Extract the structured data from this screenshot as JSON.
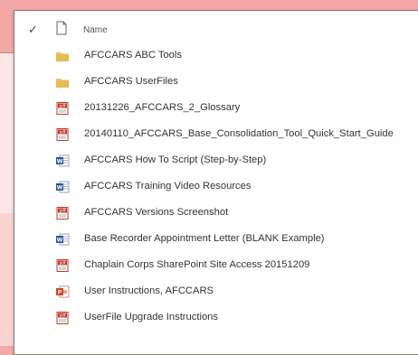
{
  "list": {
    "header": {
      "name_label": "Name",
      "check_glyph": "✓"
    },
    "items": [
      {
        "type": "folder",
        "icon": "folder-icon",
        "label": "AFCCARS ABC Tools"
      },
      {
        "type": "folder",
        "icon": "folder-icon",
        "label": "AFCCARS UserFiles"
      },
      {
        "type": "pdf",
        "icon": "pdf-icon",
        "label": "20131226_AFCCARS_2_Glossary"
      },
      {
        "type": "pdf",
        "icon": "pdf-icon",
        "label": "20140110_AFCCARS_Base_Consolidation_Tool_Quick_Start_Guide"
      },
      {
        "type": "word",
        "icon": "word-icon",
        "label": "AFCCARS How To Script (Step-by-Step)"
      },
      {
        "type": "word",
        "icon": "word-icon",
        "label": "AFCCARS Training Video Resources"
      },
      {
        "type": "pdf",
        "icon": "pdf-icon",
        "label": "AFCCARS Versions Screenshot"
      },
      {
        "type": "word",
        "icon": "word-icon",
        "label": "Base Recorder Appointment Letter (BLANK Example)"
      },
      {
        "type": "pdf",
        "icon": "pdf-icon",
        "label": "Chaplain Corps SharePoint Site Access 20151209"
      },
      {
        "type": "ppt",
        "icon": "powerpoint-icon",
        "label": "User Instructions, AFCCARS"
      },
      {
        "type": "pdf",
        "icon": "pdf-icon",
        "label": "UserFile Upgrade Instructions"
      }
    ]
  },
  "colors": {
    "page_background": "#f4a8a6",
    "panel_background": "#ffffff",
    "folder": "#f0c56a",
    "pdf": "#c33a2c",
    "word": "#2b5797",
    "powerpoint": "#d24726"
  }
}
